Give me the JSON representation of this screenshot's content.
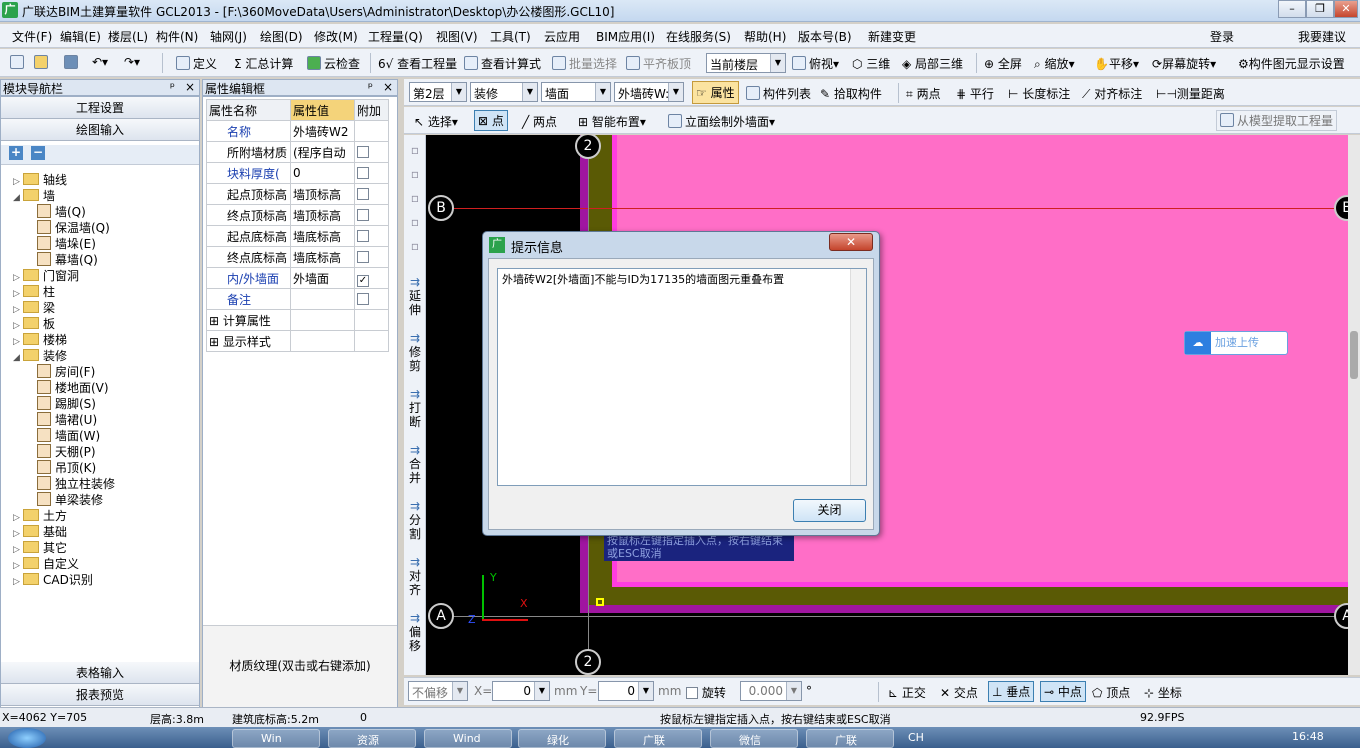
{
  "window": {
    "title": "广联达BIM土建算量软件 GCL2013 - [F:\\360MoveData\\Users\\Administrator\\Desktop\\办公楼图形.GCL10]",
    "app_icon": "广"
  },
  "menu": [
    "文件(F)",
    "编辑(E)",
    "楼层(L)",
    "构件(N)",
    "轴网(J)",
    "绘图(D)",
    "修改(M)",
    "工程量(Q)",
    "视图(V)",
    "工具(T)",
    "云应用",
    "BIM应用(I)",
    "在线服务(S)",
    "帮助(H)",
    "版本号(B)",
    "新建变更"
  ],
  "menu_right": {
    "login": "登录",
    "suggest": "我要建议"
  },
  "toolbar1": {
    "define": "定义",
    "sum": "汇总计算",
    "cloud_check": "云检查",
    "view_qty": "查看工程量",
    "view_formula": "查看计算式",
    "batch_select": "批量选择",
    "flat_board": "平齐板顶",
    "floor_combo": "当前楼层",
    "top_view": "俯视",
    "threed": "三维",
    "local3d": "局部三维",
    "fullscreen": "全屏",
    "zoom": "缩放",
    "pan": "平移",
    "rotate": "屏幕旋转",
    "display_settings": "构件图元显示设置"
  },
  "nav": {
    "header": "模块导航栏",
    "project_settings": "工程设置",
    "drawing_input": "绘图输入",
    "table_input": "表格输入",
    "report_preview": "报表预览",
    "tree": [
      {
        "label": "轴线",
        "level": 0,
        "exp": "▷"
      },
      {
        "label": "墙",
        "level": 0,
        "exp": "◢"
      },
      {
        "label": "墙(Q)",
        "level": 1
      },
      {
        "label": "保温墙(Q)",
        "level": 1
      },
      {
        "label": "墙垛(E)",
        "level": 1
      },
      {
        "label": "幕墙(Q)",
        "level": 1
      },
      {
        "label": "门窗洞",
        "level": 0,
        "exp": "▷"
      },
      {
        "label": "柱",
        "level": 0,
        "exp": "▷"
      },
      {
        "label": "梁",
        "level": 0,
        "exp": "▷"
      },
      {
        "label": "板",
        "level": 0,
        "exp": "▷"
      },
      {
        "label": "楼梯",
        "level": 0,
        "exp": "▷"
      },
      {
        "label": "装修",
        "level": 0,
        "exp": "◢"
      },
      {
        "label": "房间(F)",
        "level": 1
      },
      {
        "label": "楼地面(V)",
        "level": 1
      },
      {
        "label": "踢脚(S)",
        "level": 1
      },
      {
        "label": "墙裙(U)",
        "level": 1
      },
      {
        "label": "墙面(W)",
        "level": 1
      },
      {
        "label": "天棚(P)",
        "level": 1
      },
      {
        "label": "吊顶(K)",
        "level": 1
      },
      {
        "label": "独立柱装修",
        "level": 1
      },
      {
        "label": "单梁装修",
        "level": 1
      },
      {
        "label": "土方",
        "level": 0,
        "exp": "▷"
      },
      {
        "label": "基础",
        "level": 0,
        "exp": "▷"
      },
      {
        "label": "其它",
        "level": 0,
        "exp": "▷"
      },
      {
        "label": "自定义",
        "level": 0,
        "exp": "▷"
      },
      {
        "label": "CAD识别",
        "level": 0,
        "exp": "▷"
      }
    ]
  },
  "props": {
    "header": "属性编辑框",
    "col_name": "属性名称",
    "col_value": "属性值",
    "col_extra": "附加",
    "rows": [
      {
        "name": "名称",
        "value": "外墙砖W2",
        "blue": true,
        "chk": null
      },
      {
        "name": "所附墙材质",
        "value": "(程序自动",
        "chk": false
      },
      {
        "name": "块料厚度(",
        "value": "0",
        "blue": true,
        "chk": false
      },
      {
        "name": "起点顶标高",
        "value": "墙顶标高",
        "chk": false
      },
      {
        "name": "终点顶标高",
        "value": "墙顶标高",
        "chk": false
      },
      {
        "name": "起点底标高",
        "value": "墙底标高",
        "chk": false
      },
      {
        "name": "终点底标高",
        "value": "墙底标高",
        "chk": false
      },
      {
        "name": "内/外墙面",
        "value": "外墙面",
        "blue": true,
        "chk": true
      },
      {
        "name": "备注",
        "value": "",
        "blue": true,
        "chk": false
      }
    ],
    "groups": [
      "计算属性",
      "显示样式"
    ],
    "texture": "材质纹理(双击或右键添加)"
  },
  "toolbar2": {
    "floor": "第2层",
    "cat": "装修",
    "type": "墙面",
    "item": "外墙砖W:",
    "attr": "属性",
    "list": "构件列表",
    "pick": "拾取构件",
    "twopoint": "两点",
    "parallel": "平行",
    "length_mark": "长度标注",
    "align_mark": "对齐标注",
    "measure": "测量距离"
  },
  "toolbar3": {
    "select": "选择",
    "point": "点",
    "twopoint": "两点",
    "smart": "智能布置",
    "elev": "立面绘制外墙面",
    "extract": "从模型提取工程量"
  },
  "lefttools": [
    "延伸",
    "修剪",
    "打断",
    "合并",
    "分割",
    "对齐",
    "偏移"
  ],
  "canvas": {
    "axes": {
      "top": "2",
      "bottom": "2",
      "left_b": "B",
      "right_b": "B",
      "left_a": "A",
      "right_a": "A"
    },
    "hint": "按鼠标左键指定插入点，按右键结束或ESC取消",
    "axis_x": "X",
    "axis_y": "Y",
    "axis_z": "Z",
    "upload": "加速上传"
  },
  "dialog": {
    "title": "提示信息",
    "message": "外墙砖W2[外墙面]不能与ID为17135的墙面图元重叠布置",
    "close": "关闭",
    "x": "✕"
  },
  "bottomtb": {
    "nooffset": "不偏移",
    "x_label": "X=",
    "x_val": "0",
    "mm1": "mm",
    "y_label": "Y=",
    "y_val": "0",
    "mm2": "mm",
    "rotate": "旋转",
    "angle": "0.000",
    "deg": "°",
    "ortho": "正交",
    "intersect": "交点",
    "perp": "垂点",
    "mid": "中点",
    "vertex": "顶点",
    "coord": "坐标"
  },
  "status": {
    "coords": "X=4062 Y=705",
    "floor_h": "层高:3.8m",
    "base_elev": "建筑底标高:5.2m",
    "zero": "0",
    "hint": "按鼠标左键指定插入点，按右键结束或ESC取消",
    "fps": "92.9FPS"
  },
  "taskbar": {
    "items": [
      "Win",
      "资源",
      "Wind",
      "绿化",
      "广联",
      "微信",
      "广联"
    ],
    "lang": "CH",
    "time": "16:48"
  }
}
